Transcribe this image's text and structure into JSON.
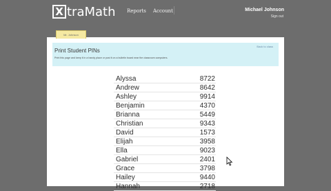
{
  "header": {
    "logo": {
      "icon_letter": "X",
      "text": "traMath"
    },
    "nav": {
      "reports": "Reports",
      "account": "Account"
    },
    "user": {
      "name": "Michael Johnson",
      "sign_out": "Sign out"
    }
  },
  "tab": {
    "label": "Mr. Johnson"
  },
  "banner": {
    "title": "Print Student PINs",
    "description": "Print this page and keep it in a handy place or post it on a bulletin board near the classroom computers.",
    "back_link": "Back to class"
  },
  "pins": {
    "rows": [
      {
        "name": "Alyssa",
        "pin": "8722"
      },
      {
        "name": "Andrew",
        "pin": "8642"
      },
      {
        "name": "Ashley",
        "pin": "9914"
      },
      {
        "name": "Benjamin",
        "pin": "4370"
      },
      {
        "name": "Brianna",
        "pin": "5449"
      },
      {
        "name": "Christian",
        "pin": "9343"
      },
      {
        "name": "David",
        "pin": "1573"
      },
      {
        "name": "Elijah",
        "pin": "3958"
      },
      {
        "name": "Ella",
        "pin": "9023"
      },
      {
        "name": "Gabriel",
        "pin": "2401"
      },
      {
        "name": "Grace",
        "pin": "3798"
      },
      {
        "name": "Hailey",
        "pin": "9440"
      },
      {
        "name": "Hannah",
        "pin": "2718"
      }
    ]
  },
  "colors": {
    "background": "#6d6d6d",
    "banner": "#d4f1f6",
    "tab": "#f5e9a2"
  }
}
